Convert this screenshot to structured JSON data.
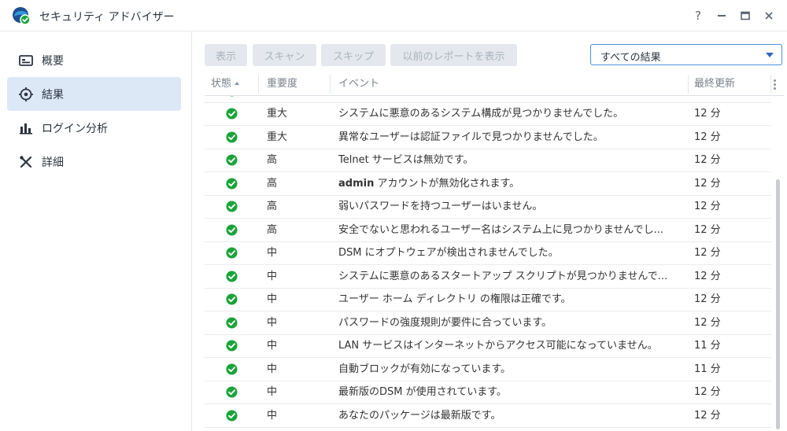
{
  "app": {
    "title": "セキュリティ アドバイザー"
  },
  "window_controls": {
    "help": "?",
    "minimize": "−",
    "maximize": "□",
    "close": "×"
  },
  "sidebar": {
    "items": [
      {
        "label": "概要",
        "icon": "overview-icon",
        "active": false
      },
      {
        "label": "結果",
        "icon": "target-icon",
        "active": true
      },
      {
        "label": "ログイン分析",
        "icon": "bar-chart-icon",
        "active": false
      },
      {
        "label": "詳細",
        "icon": "tools-icon",
        "active": false
      }
    ]
  },
  "toolbar": {
    "show": "表示",
    "scan": "スキャン",
    "skip": "スキップ",
    "prev_report": "以前のレポートを表示",
    "filter_value": "すべての結果"
  },
  "table": {
    "headers": {
      "status": "状態",
      "severity": "重要度",
      "event": "イベント",
      "updated": "最終更新"
    },
    "rows": [
      {
        "status": "ok",
        "severity": "重大",
        "event_pre": "",
        "event_bold": "",
        "event": "システムに悪意のあるシステム構成が見つかりませんでした。",
        "updated": "12 分"
      },
      {
        "status": "ok",
        "severity": "重大",
        "event_pre": "",
        "event_bold": "",
        "event": "異常なユーザーは認証ファイルで見つかりませんでした。",
        "updated": "12 分"
      },
      {
        "status": "ok",
        "severity": "高",
        "event_pre": "",
        "event_bold": "",
        "event": "Telnet サービスは無効です。",
        "updated": "12 分"
      },
      {
        "status": "ok",
        "severity": "高",
        "event_pre": "",
        "event_bold": "admin",
        "event": " アカウントが無効化されます。",
        "updated": "12 分"
      },
      {
        "status": "ok",
        "severity": "高",
        "event_pre": "",
        "event_bold": "",
        "event": "弱いパスワードを持つユーザーはいません。",
        "updated": "12 分"
      },
      {
        "status": "ok",
        "severity": "高",
        "event_pre": "",
        "event_bold": "",
        "event": "安全でないと思われるユーザー名はシステム上に見つかりませんでし...",
        "updated": "12 分"
      },
      {
        "status": "ok",
        "severity": "中",
        "event_pre": "",
        "event_bold": "",
        "event": "DSM にオプトウェアが検出されませんでした。",
        "updated": "12 分"
      },
      {
        "status": "ok",
        "severity": "中",
        "event_pre": "",
        "event_bold": "",
        "event": "システムに悪意のあるスタートアップ スクリプトが見つかりませんで...",
        "updated": "12 分"
      },
      {
        "status": "ok",
        "severity": "中",
        "event_pre": "",
        "event_bold": "",
        "event": "ユーザー ホーム ディレクトリ の権限は正確です。",
        "updated": "12 分"
      },
      {
        "status": "ok",
        "severity": "中",
        "event_pre": "",
        "event_bold": "",
        "event": "パスワードの強度規則が要件に合っています。",
        "updated": "12 分"
      },
      {
        "status": "ok",
        "severity": "中",
        "event_pre": "",
        "event_bold": "",
        "event": "LAN サービスはインターネットからアクセス可能になっていません。",
        "updated": "11 分"
      },
      {
        "status": "ok",
        "severity": "中",
        "event_pre": "",
        "event_bold": "",
        "event": "自動ブロックが有効になっています。",
        "updated": "11 分"
      },
      {
        "status": "ok",
        "severity": "中",
        "event_pre": "",
        "event_bold": "",
        "event": "最新版のDSM が使用されています。",
        "updated": "12 分"
      },
      {
        "status": "ok",
        "severity": "中",
        "event_pre": "",
        "event_bold": "",
        "event": "あなたのパッケージは最新版です。",
        "updated": "12 分"
      }
    ]
  },
  "colors": {
    "ok": "#1ba33b",
    "active_nav": "#dde8f7",
    "accent": "#2e66c2"
  }
}
